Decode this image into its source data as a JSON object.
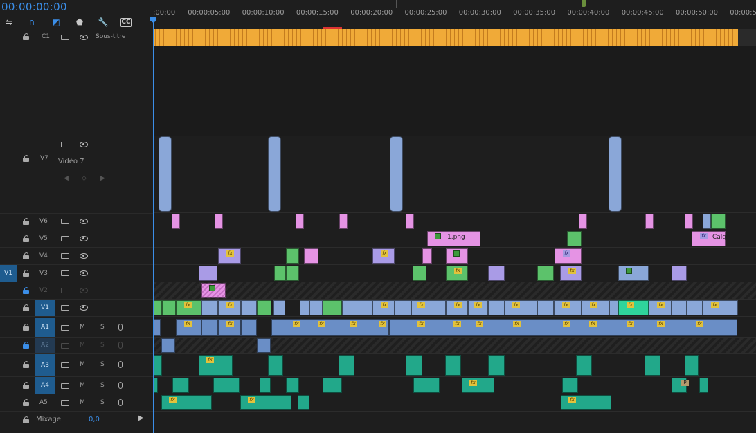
{
  "timecode": "00:00:00:00",
  "toolbar": {
    "icons": [
      "insert-icon",
      "snap-magnet-icon",
      "linked-selection-icon",
      "marker-icon",
      "wrench-icon",
      "captions-icon"
    ],
    "captions_label": "CC"
  },
  "ruler": {
    "labels": [
      ":00:00",
      "00:00:05:00",
      "00:00:10:00",
      "00:00:15:00",
      "00:00:20:00",
      "00:00:25:00",
      "00:00:30:00",
      "00:00:35:00",
      "00:00:40:00",
      "00:00:45:00",
      "00:00:50:00",
      "00:00:5"
    ]
  },
  "tracks": {
    "c1": {
      "id": "C1",
      "name": "Sous-titre"
    },
    "v7": {
      "id": "V7",
      "name": "Vidéo 7"
    },
    "v6": {
      "id": "V6"
    },
    "v5": {
      "id": "V5"
    },
    "v4": {
      "id": "V4"
    },
    "v3": {
      "id": "V3"
    },
    "v2": {
      "id": "V2"
    },
    "v1": {
      "id": "V1",
      "source": "V1"
    },
    "a1": {
      "id": "A1"
    },
    "a2": {
      "id": "A2"
    },
    "a3": {
      "id": "A3"
    },
    "a4": {
      "id": "A4"
    },
    "a5": {
      "id": "A5"
    }
  },
  "audio_buttons": {
    "mute": "M",
    "solo": "S"
  },
  "mix": {
    "label": "Mixage",
    "value": "0,0"
  },
  "clip_labels": {
    "png": "1.png",
    "calq": "Calq",
    "fx": "fx",
    "p": "P"
  },
  "colors": {
    "accent": "#3b8ee8",
    "caption": "#e8a73a",
    "video_blue": "#8aa7d8",
    "pink": "#e593e4",
    "green": "#5cc26b",
    "violet": "#a99be6",
    "audio": "#22a88a"
  }
}
